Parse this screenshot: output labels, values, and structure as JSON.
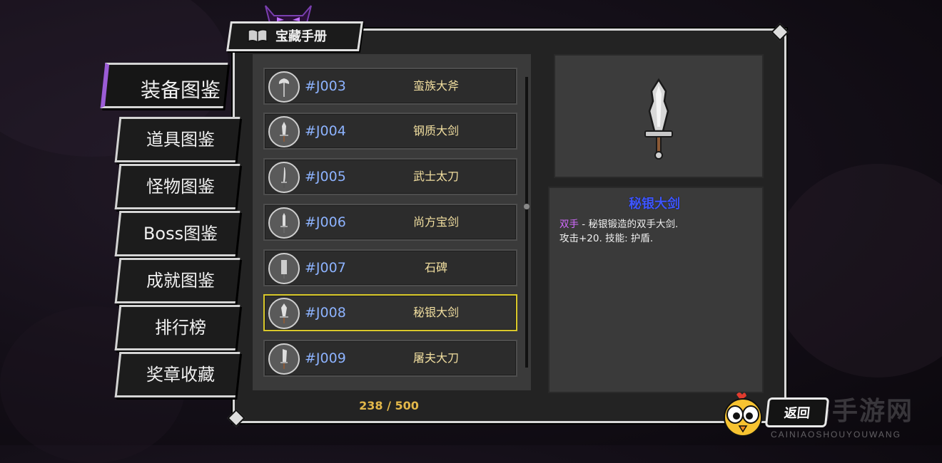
{
  "header": {
    "title": "宝藏手册",
    "book_icon": "book-icon",
    "horns_icon": "demon-horns-icon"
  },
  "nav": {
    "items": [
      {
        "label": "装备图鉴",
        "active": true
      },
      {
        "label": "道具图鉴",
        "active": false
      },
      {
        "label": "怪物图鉴",
        "active": false
      },
      {
        "label": "Boss图鉴",
        "active": false
      },
      {
        "label": "成就图鉴",
        "active": false
      },
      {
        "label": "排行榜",
        "active": false
      },
      {
        "label": "奖章收藏",
        "active": false
      }
    ]
  },
  "list": {
    "items": [
      {
        "code": "#J003",
        "name": "蛮族大斧",
        "selected": false
      },
      {
        "code": "#J004",
        "name": "钢质大剑",
        "selected": false
      },
      {
        "code": "#J005",
        "name": "武士太刀",
        "selected": false
      },
      {
        "code": "#J006",
        "name": "尚方宝剑",
        "selected": false
      },
      {
        "code": "#J007",
        "name": "石碑",
        "selected": false
      },
      {
        "code": "#J008",
        "name": "秘银大剑",
        "selected": true
      },
      {
        "code": "#J009",
        "name": "屠夫大刀",
        "selected": false
      }
    ],
    "count": "238 / 500"
  },
  "detail": {
    "title": "秘银大剑",
    "tag": "双手",
    "line1": " - 秘银锻造的双手大剑.",
    "line2": "攻击+20. 技能: 护盾."
  },
  "footer": {
    "back_label": "返回"
  },
  "watermark": {
    "text": "菜鸟手游网",
    "sub": "CAINIAOSHOUYOUWANG"
  },
  "colors": {
    "accent_purple": "#9b5cd6",
    "selected_border": "#d9c82a",
    "code_blue": "#8db3ff",
    "name_gold": "#f2dfa0",
    "count_gold": "#e3b84a",
    "title_blue": "#3e56ff",
    "tag_purple": "#d36bff"
  }
}
